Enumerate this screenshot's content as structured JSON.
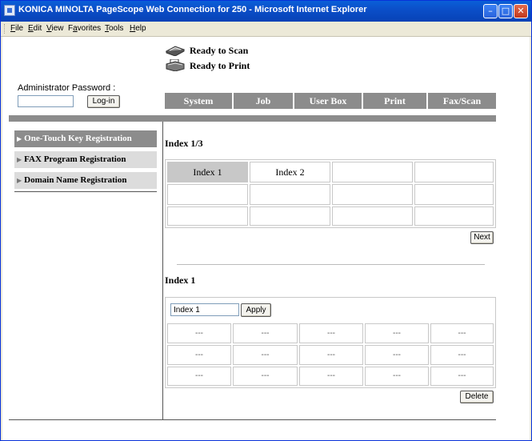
{
  "window": {
    "title": "KONICA MINOLTA PageScope Web Connection for 250 - Microsoft Internet Explorer",
    "minimize": "–",
    "maximize": "□",
    "close": "✕"
  },
  "menu": {
    "items": [
      {
        "label": "File",
        "key": "F",
        "rest": "ile"
      },
      {
        "label": "Edit",
        "key": "E",
        "rest": "dit"
      },
      {
        "label": "View",
        "key": "V",
        "rest": "iew"
      },
      {
        "label": "Favorites",
        "key": "a",
        "pre": "F",
        "rest": "vorites"
      },
      {
        "label": "Tools",
        "key": "T",
        "rest": "ools"
      },
      {
        "label": "Help",
        "key": "H",
        "rest": "elp"
      }
    ]
  },
  "status": {
    "scan": "Ready to Scan",
    "print": "Ready to Print",
    "icon_scan": "scanner-icon",
    "icon_print": "printer-icon"
  },
  "admin": {
    "label": "Administrator Password :",
    "password_value": "",
    "login_button": "Log-in"
  },
  "tabs": [
    "System",
    "Job",
    "User Box",
    "Print",
    "Fax/Scan"
  ],
  "sidebar": {
    "items": [
      {
        "label": "One-Touch Key Registration",
        "active": true
      },
      {
        "label": "FAX Program Registration",
        "active": false
      },
      {
        "label": "Domain Name Registration",
        "active": false
      }
    ]
  },
  "index_section": {
    "heading": "Index 1/3",
    "cells": [
      [
        "Index 1",
        "Index 2",
        "",
        ""
      ],
      [
        "",
        "",
        "",
        ""
      ],
      [
        "",
        "",
        "",
        ""
      ]
    ],
    "selected": "Index 1",
    "next_button": "Next"
  },
  "detail_section": {
    "heading": "Index 1",
    "name_value": "Index 1",
    "apply_button": "Apply",
    "rows": [
      [
        "---",
        "---",
        "---",
        "---",
        "---"
      ],
      [
        "---",
        "---",
        "---",
        "---",
        "---"
      ],
      [
        "---",
        "---",
        "---",
        "---",
        "---"
      ]
    ],
    "delete_button": "Delete"
  },
  "colors": {
    "tab_bg": "#8c8c8c",
    "sidebar_active": "#8c8c8c",
    "sidebar_inactive": "#dcdcdc",
    "selected_cell": "#c8c8c8"
  }
}
